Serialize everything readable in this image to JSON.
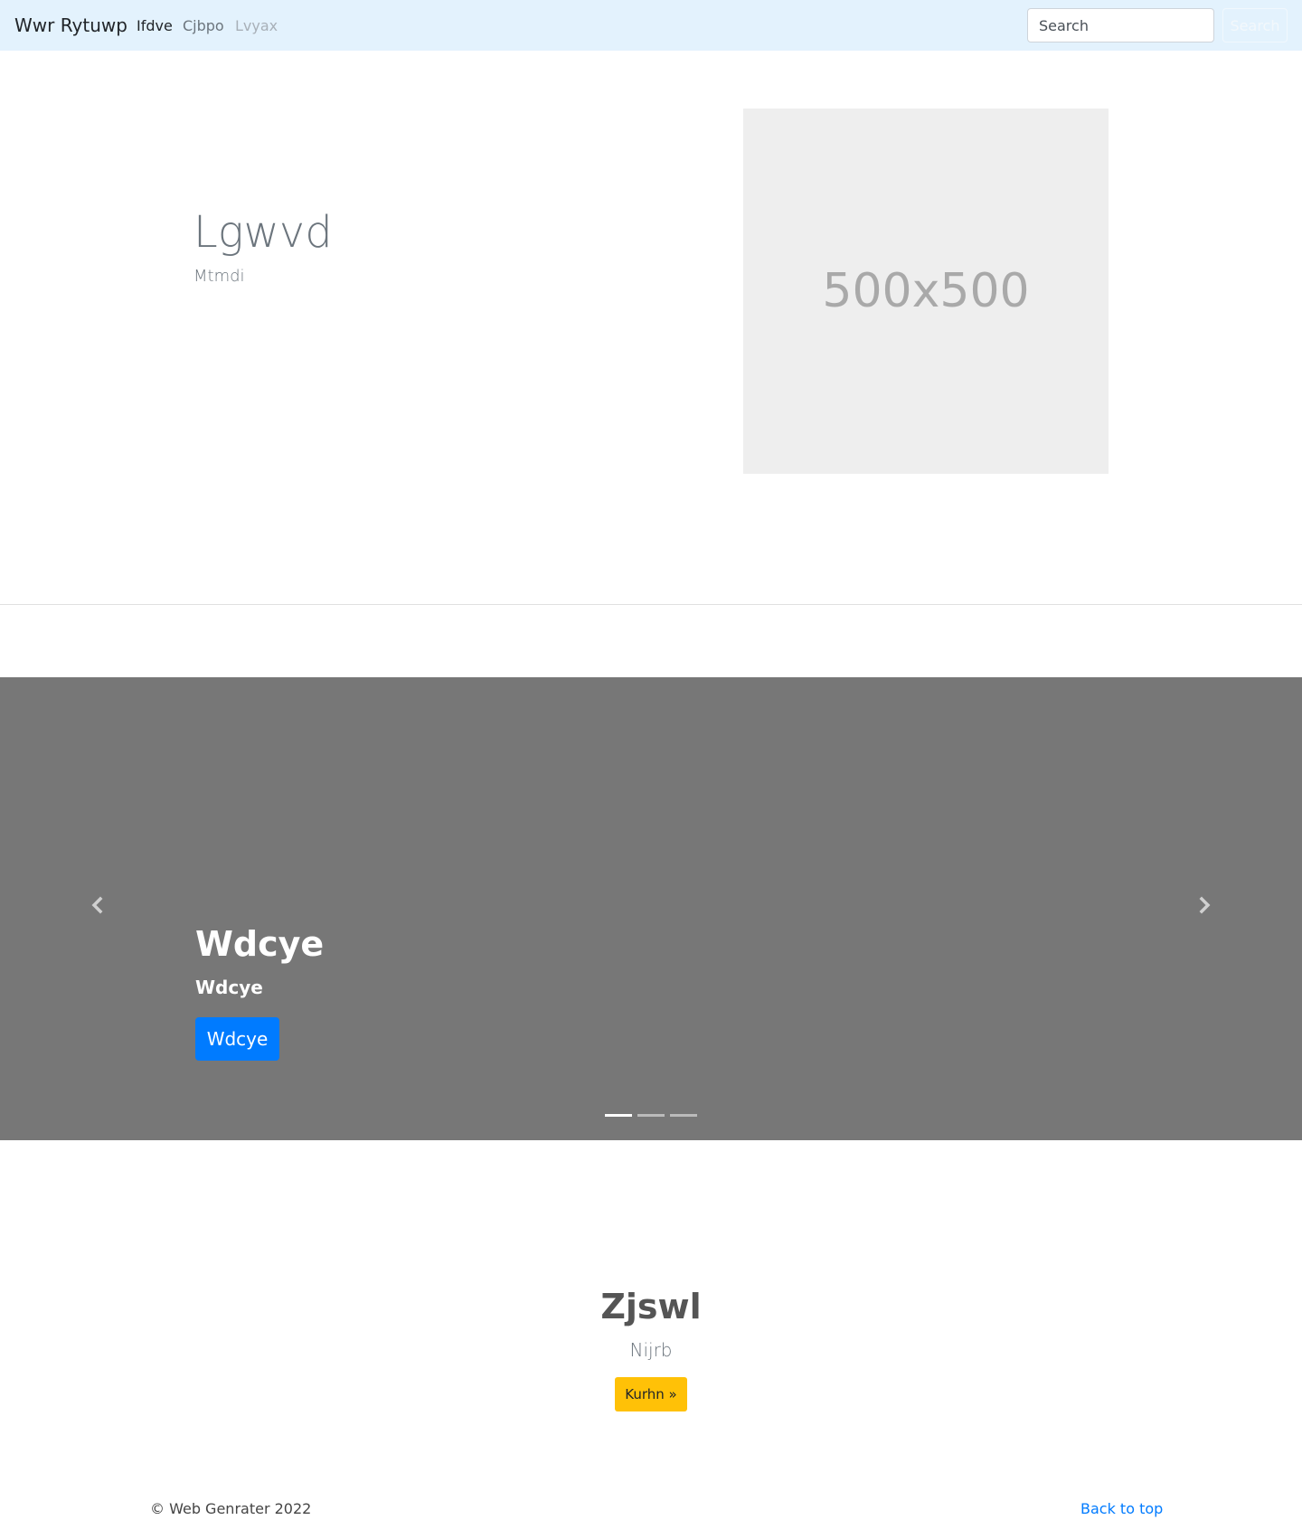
{
  "navbar": {
    "brand": "Wwr Rytuwp",
    "links": [
      {
        "label": "Ifdve",
        "state": "active"
      },
      {
        "label": "Cjbpo",
        "state": "normal"
      },
      {
        "label": "Lvyax",
        "state": "disabled"
      }
    ],
    "search_placeholder": "Search",
    "search_button": "Search",
    "background_color": "#e3f2fd"
  },
  "hero": {
    "title": "Lgwvd",
    "subtitle": "Mtmdi",
    "image_label": "500x500"
  },
  "carousel": {
    "title": "Wdcye",
    "subtitle": "Wdcye",
    "button_label": "Wdcye",
    "prev_icon": "chevron-left-icon",
    "next_icon": "chevron-right-icon",
    "indicator_count": 3,
    "active_indicator": 0,
    "background_color": "#777777",
    "button_color": "#007bff"
  },
  "feature": {
    "title": "Zjswl",
    "subtitle": "Nijrb",
    "button_label": "Kurhn »",
    "button_color": "#ffc107"
  },
  "footer": {
    "copyright": "© Web Genrater 2022",
    "back_to_top": "Back to top",
    "link_color": "#007bff"
  }
}
